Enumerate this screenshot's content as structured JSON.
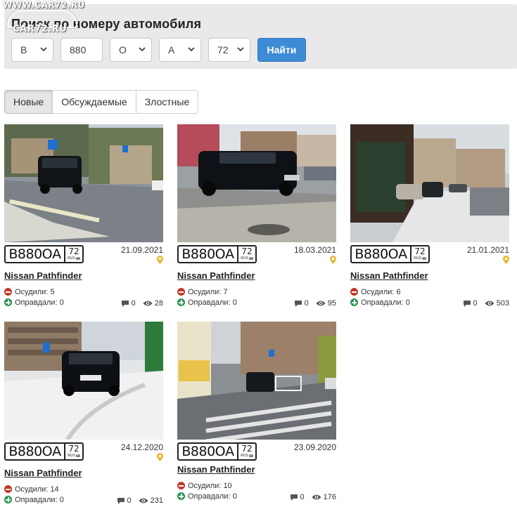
{
  "watermark": {
    "site": "WWW.CAR72.RU",
    "short": "CAR72.RU"
  },
  "search": {
    "title": "Поиск по номеру автомобиля",
    "letter1": "В",
    "digits": "880",
    "letter2": "О",
    "letter3": "А",
    "region": "72",
    "button": "Найти"
  },
  "tabs": [
    {
      "label": "Новые",
      "active": true
    },
    {
      "label": "Обсуждаемые",
      "active": false
    },
    {
      "label": "Злостные",
      "active": false
    }
  ],
  "cards": [
    {
      "plate": "В880ОА",
      "region": "72",
      "rus": "RUS",
      "date": "21.09.2021",
      "title": "Nissan Pathfinder",
      "condemned_label": "Осудили:",
      "condemned": "5",
      "justified_label": "Оправдали:",
      "justified": "0",
      "comments": "0",
      "views": "28"
    },
    {
      "plate": "В880ОА",
      "region": "72",
      "rus": "RUS",
      "date": "18.03.2021",
      "title": "Nissan Pathfinder",
      "condemned_label": "Осудили:",
      "condemned": "7",
      "justified_label": "Оправдали:",
      "justified": "0",
      "comments": "0",
      "views": "95"
    },
    {
      "plate": "В880ОА",
      "region": "72",
      "rus": "RUS",
      "date": "21.01.2021",
      "title": "Nissan Pathfinder",
      "condemned_label": "Осудили:",
      "condemned": "6",
      "justified_label": "Оправдали:",
      "justified": "0",
      "comments": "0",
      "views": "503"
    },
    {
      "plate": "В880ОА",
      "region": "72",
      "rus": "RUS",
      "date": "24.12.2020",
      "title": "Nissan Pathfinder",
      "condemned_label": "Осудили:",
      "condemned": "14",
      "justified_label": "Оправдали:",
      "justified": "0",
      "comments": "0",
      "views": "231"
    },
    {
      "plate": "В880ОА",
      "region": "72",
      "rus": "RUS",
      "date": "23.09.2020",
      "title": "Nissan Pathfinder",
      "condemned_label": "Осудили:",
      "condemned": "10",
      "justified_label": "Оправдали:",
      "justified": "0",
      "comments": "0",
      "views": "176"
    }
  ],
  "colors": {
    "button": "#3d8bd4",
    "condemn": "#c0392b",
    "justify": "#27944f",
    "pin": "#e8b83a"
  },
  "icons": {
    "condemn": "minus-circle-icon",
    "justify": "plus-circle-icon",
    "comments": "comment-icon",
    "views": "eye-icon",
    "location": "map-pin-icon"
  }
}
